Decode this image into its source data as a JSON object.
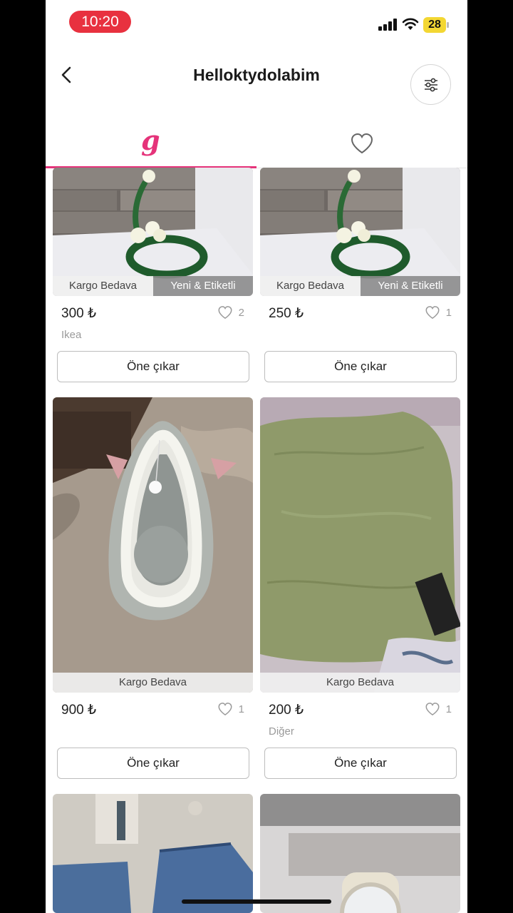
{
  "status_bar": {
    "time": "10:20",
    "battery": "28"
  },
  "header": {
    "title": "Helloktydolabim"
  },
  "tabs": {
    "closet_logo": "g"
  },
  "products": [
    {
      "price": "300 ₺",
      "likes": "2",
      "brand": "Ikea",
      "badges": [
        "Kargo Bedava",
        "Yeni & Etiketli"
      ],
      "cta": "Öne çıkar"
    },
    {
      "price": "250 ₺",
      "likes": "1",
      "brand": "",
      "badges": [
        "Kargo Bedava",
        "Yeni & Etiketli"
      ],
      "cta": "Öne çıkar"
    },
    {
      "price": "900 ₺",
      "likes": "1",
      "brand": "",
      "badges": [
        "Kargo Bedava"
      ],
      "cta": "Öne çıkar"
    },
    {
      "price": "200 ₺",
      "likes": "1",
      "brand": "Diğer",
      "badges": [
        "Kargo Bedava"
      ],
      "cta": "Öne çıkar"
    }
  ],
  "colors": {
    "accent": "#e5337a",
    "time_pill": "#e8313f",
    "battery": "#f3d733"
  }
}
